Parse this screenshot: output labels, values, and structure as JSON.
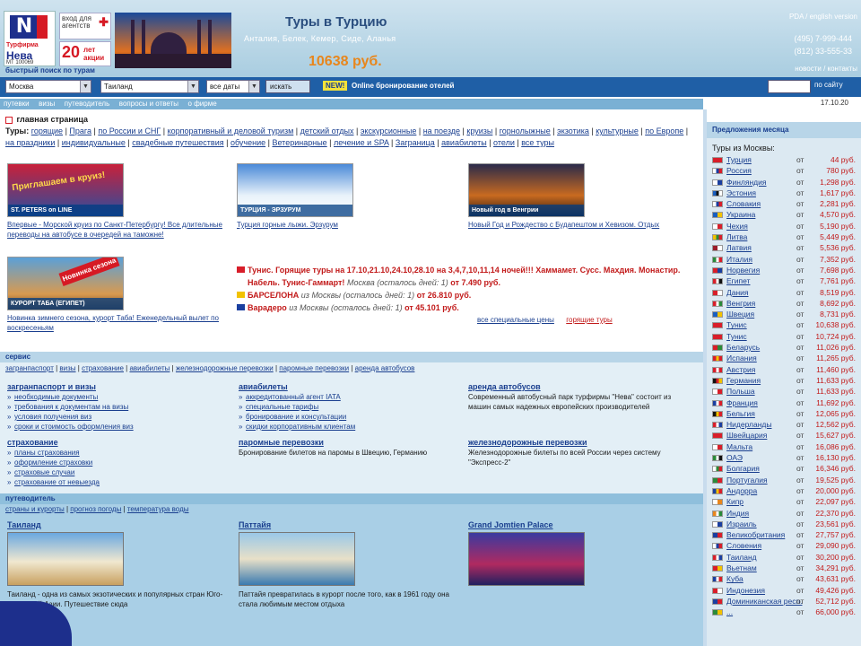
{
  "header": {
    "logo": {
      "brand": "Нева",
      "tagline": "Турфирма",
      "sub": "МТ 100069",
      "letter": "N"
    },
    "agent_link": "вход для агентств",
    "years": {
      "number": "20",
      "label": "лет акции"
    },
    "hero_title": "Туры в Турцию",
    "hero_cities": "Анталия, Белек, Кемер, Сиде, Аланья",
    "hero_price": "10638 руб.",
    "lang_links": "PDA / english version",
    "phones": [
      "(495) 7-999-444",
      "(812) 33-555-33"
    ],
    "header_nav": "новости / контакты",
    "search_label": "быстрый поиск по турам"
  },
  "searchbar": {
    "from_value": "Москва",
    "to_value": "Таиланд",
    "date_value": "все даты",
    "search_button": "искать",
    "new_label": "NEW!",
    "online_booking": "Online бронирование отелей",
    "site_search_button": "по сайту"
  },
  "nav": {
    "items": [
      "путевки",
      "визы",
      "путеводитель",
      "вопросы и ответы",
      "о фирме"
    ],
    "date": "17.10.20"
  },
  "crumb": "главная страница",
  "tour_links": {
    "label": "Туры:",
    "items": [
      "горящие",
      "Прага",
      "по России и СНГ",
      "корпоративный и деловой туризм",
      "детский отдых",
      "экскурсионные",
      "на поезде",
      "круизы",
      "горнолыжные",
      "экзотика",
      "культурные",
      "по Европе",
      "на праздники",
      "индивидуальные",
      "свадебные путешествия",
      "обучение",
      "Ветеринарные",
      "лечение и SPA",
      "Заграница",
      "авиабилеты",
      "отели",
      "все туры"
    ]
  },
  "promos": [
    {
      "caption": "ST. PETERS on LINE",
      "overlay": "Приглашаем в круиз!",
      "text": "Впервые - Морской круиз по Санкт-Петербургу! Все длительные переводы на автобусе в очередей на таможне!"
    },
    {
      "caption": "ТУРЦИЯ - ЭРЗУРУМ",
      "text": "Турция горные лыжи. Эрзурум"
    },
    {
      "caption": "Новый год в Венгрии",
      "text": "Новый Год и Рождество с Будапештом и Хевизом. Отдых"
    },
    {
      "caption": "КУРОРТ ТАБА (ЕГИПЕТ)",
      "overlay": "Новинка сезона",
      "text": "Новинка зимнего сезона, курорт Таба! Еженедельный вылет по воскресеньям"
    }
  ],
  "news": [
    {
      "flag_color": "#d81e2a",
      "text_red": "Тунис. Горящие туры на 17.10,21.10,24.10,28.10 на 3,4,7,10,11,14 ночей!!! Хаммамет. Сусс. Махдия. Монастир. Набель. Тунис-Гаммарт!",
      "italic": "Москва (осталось дней: 1)",
      "suffix": "от 7.490 руб."
    },
    {
      "flag_color": "#f2c200",
      "text_red": "БАРСЕЛОНА",
      "italic": "из Москвы (осталось дней: 1)",
      "suffix": "от 26.810 руб."
    },
    {
      "flag_color": "#1a3fa0",
      "text_red": "Варадеро",
      "italic": "из Москвы (осталось дней: 1)",
      "suffix": "от 45.101 руб."
    }
  ],
  "special_links": {
    "all": "все специальные цены",
    "hot": "горящие туры"
  },
  "services": {
    "head": "сервис",
    "links": [
      "загранпаспорт",
      "визы",
      "страхование",
      "авиабилеты",
      "железнодорожные перевозки",
      "паромные перевозки",
      "аренда автобусов"
    ],
    "columns": [
      {
        "title": "загранпаспорт и визы",
        "items": [
          "необходимые документы",
          "требования к документам на визы",
          "условия получения виз",
          "сроки и стоимость оформления виз"
        ]
      },
      {
        "title": "авиабилеты",
        "items": [
          "аккредитованный агент IATA",
          "специальные тарифы",
          "бронирование и консультации",
          "скидки корпоративным клиентам"
        ]
      },
      {
        "title": "аренда автобусов",
        "text": "Современный автобусный парк турфирмы \"Нева\" состоит из машин самых надежных европейских производителей"
      },
      {
        "title": "страхование",
        "items": [
          "планы страхования",
          "оформление страховки",
          "страховые случаи",
          "страхование от невыезда"
        ]
      },
      {
        "title": "паромные перевозки",
        "text": "Бронирование билетов на паромы в Швецию, Германию"
      },
      {
        "title": "железнодорожные перевозки",
        "text": "Железнодорожные билеты по всей России через систему \"Экспресс-2\""
      }
    ]
  },
  "guide": {
    "head": "путеводитель",
    "links": [
      "страны и курорты",
      "прогноз погоды",
      "температура воды"
    ],
    "columns": [
      {
        "title": "Таиланд",
        "text": "Таиланд - одна из самых экзотических и популярных стран Юго-Восточной Азии. Путешествие сюда"
      },
      {
        "title": "Паттайя",
        "text": "Паттайя превратилась в курорт после того, как в 1961 году она стала любимым местом отдыха"
      },
      {
        "title": "Grand Jomtien Palace",
        "text": ""
      }
    ]
  },
  "sidebar": {
    "head": "Предложения месяца",
    "sub": "Туры из Москвы:",
    "from_label": "от",
    "rows": [
      {
        "country": "Турция",
        "price": "44 руб.",
        "flag": [
          "#d81e2a",
          "#d81e2a"
        ]
      },
      {
        "country": "Россия",
        "price": "780 руб.",
        "flag": [
          "#ffffff",
          "#1a3fa0",
          "#d81e2a"
        ]
      },
      {
        "country": "Финляндия",
        "price": "1,298 руб.",
        "flag": [
          "#ffffff",
          "#1a3fa0"
        ]
      },
      {
        "country": "Эстония",
        "price": "1,617 руб.",
        "flag": [
          "#1a5fc0",
          "#111111",
          "#ffffff"
        ]
      },
      {
        "country": "Словакия",
        "price": "2,281 руб.",
        "flag": [
          "#ffffff",
          "#1a3fa0",
          "#d81e2a"
        ]
      },
      {
        "country": "Украина",
        "price": "4,570 руб.",
        "flag": [
          "#1a5fc0",
          "#f2c200"
        ]
      },
      {
        "country": "Чехия",
        "price": "5,190 руб.",
        "flag": [
          "#ffffff",
          "#d81e2a"
        ]
      },
      {
        "country": "Литва",
        "price": "5,449 руб.",
        "flag": [
          "#f2c200",
          "#2a8a3a",
          "#d81e2a"
        ]
      },
      {
        "country": "Латвия",
        "price": "5,536 руб.",
        "flag": [
          "#9a1c2a",
          "#ffffff"
        ]
      },
      {
        "country": "Италия",
        "price": "7,352 руб.",
        "flag": [
          "#2a8a3a",
          "#ffffff",
          "#d81e2a"
        ]
      },
      {
        "country": "Норвегия",
        "price": "7,698 руб.",
        "flag": [
          "#d81e2a",
          "#1a3fa0"
        ]
      },
      {
        "country": "Египет",
        "price": "7,761 руб.",
        "flag": [
          "#d81e2a",
          "#ffffff",
          "#111111"
        ]
      },
      {
        "country": "Дания",
        "price": "8,519 руб.",
        "flag": [
          "#d81e2a",
          "#ffffff"
        ]
      },
      {
        "country": "Венгрия",
        "price": "8,692 руб.",
        "flag": [
          "#d81e2a",
          "#ffffff",
          "#2a8a3a"
        ]
      },
      {
        "country": "Швеция",
        "price": "8,731 руб.",
        "flag": [
          "#1a5fc0",
          "#f2c200"
        ]
      },
      {
        "country": "Тунис",
        "price": "10,638 руб.",
        "flag": [
          "#d81e2a",
          "#d81e2a"
        ]
      },
      {
        "country": "Тунис",
        "price": "10,724 руб.",
        "flag": [
          "#d81e2a",
          "#d81e2a"
        ]
      },
      {
        "country": "Беларусь",
        "price": "11,026 руб.",
        "flag": [
          "#d81e2a",
          "#2a8a3a"
        ]
      },
      {
        "country": "Испания",
        "price": "11,265 руб.",
        "flag": [
          "#d81e2a",
          "#f2c200",
          "#d81e2a"
        ]
      },
      {
        "country": "Австрия",
        "price": "11,460 руб.",
        "flag": [
          "#d81e2a",
          "#ffffff",
          "#d81e2a"
        ]
      },
      {
        "country": "Германия",
        "price": "11,633 руб.",
        "flag": [
          "#111111",
          "#d81e2a",
          "#f2c200"
        ]
      },
      {
        "country": "Польша",
        "price": "11,633 руб.",
        "flag": [
          "#ffffff",
          "#d81e2a"
        ]
      },
      {
        "country": "Франция",
        "price": "11,692 руб.",
        "flag": [
          "#1a3fa0",
          "#ffffff",
          "#d81e2a"
        ]
      },
      {
        "country": "Бельгия",
        "price": "12,065 руб.",
        "flag": [
          "#111111",
          "#f2c200",
          "#d81e2a"
        ]
      },
      {
        "country": "Нидерланды",
        "price": "12,562 руб.",
        "flag": [
          "#d81e2a",
          "#ffffff",
          "#1a3fa0"
        ]
      },
      {
        "country": "Швейцария",
        "price": "15,627 руб.",
        "flag": [
          "#d81e2a",
          "#d81e2a"
        ]
      },
      {
        "country": "Мальта",
        "price": "16,086 руб.",
        "flag": [
          "#ffffff",
          "#d81e2a"
        ]
      },
      {
        "country": "ОАЭ",
        "price": "16,130 руб.",
        "flag": [
          "#2a8a3a",
          "#ffffff",
          "#111111"
        ]
      },
      {
        "country": "Болгария",
        "price": "16,346 руб.",
        "flag": [
          "#ffffff",
          "#2a8a3a",
          "#d81e2a"
        ]
      },
      {
        "country": "Португалия",
        "price": "19,525 руб.",
        "flag": [
          "#2a8a3a",
          "#d81e2a"
        ]
      },
      {
        "country": "Андорра",
        "price": "20,000 руб.",
        "flag": [
          "#1a3fa0",
          "#f2c200",
          "#d81e2a"
        ]
      },
      {
        "country": "Кипр",
        "price": "22,097 руб.",
        "flag": [
          "#ffffff",
          "#e8861c"
        ]
      },
      {
        "country": "Индия",
        "price": "22,370 руб.",
        "flag": [
          "#e8861c",
          "#ffffff",
          "#2a8a3a"
        ]
      },
      {
        "country": "Израиль",
        "price": "23,561 руб.",
        "flag": [
          "#ffffff",
          "#1a3fa0"
        ]
      },
      {
        "country": "Великобритания",
        "price": "27,757 руб.",
        "flag": [
          "#1a3fa0",
          "#d81e2a"
        ]
      },
      {
        "country": "Словения",
        "price": "29,090 руб.",
        "flag": [
          "#ffffff",
          "#1a3fa0",
          "#d81e2a"
        ]
      },
      {
        "country": "Таиланд",
        "price": "30,200 руб.",
        "flag": [
          "#d81e2a",
          "#ffffff",
          "#1a3fa0"
        ]
      },
      {
        "country": "Вьетнам",
        "price": "34,291 руб.",
        "flag": [
          "#d81e2a",
          "#f2c200"
        ]
      },
      {
        "country": "Куба",
        "price": "43,631 руб.",
        "flag": [
          "#1a3fa0",
          "#ffffff",
          "#d81e2a"
        ]
      },
      {
        "country": "Индонезия",
        "price": "49,426 руб.",
        "flag": [
          "#d81e2a",
          "#ffffff"
        ]
      },
      {
        "country": "Доминиканская респ.",
        "price": "52,712 руб.",
        "flag": [
          "#1a3fa0",
          "#d81e2a"
        ]
      },
      {
        "country": "...",
        "price": "66,000 руб.",
        "flag": [
          "#2a8a3a",
          "#f2c200"
        ]
      }
    ]
  }
}
